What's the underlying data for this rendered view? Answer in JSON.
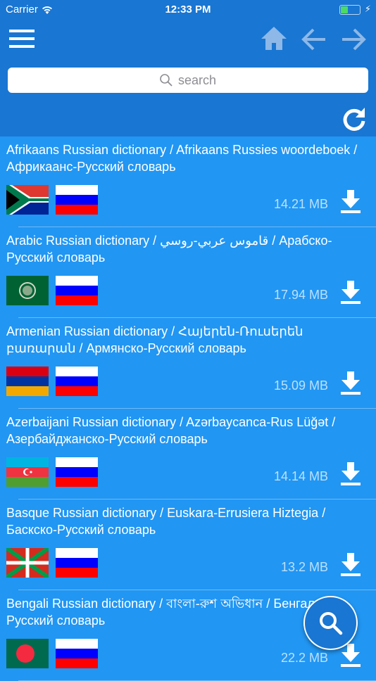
{
  "status": {
    "carrier": "Carrier",
    "time": "12:33 PM",
    "battery_level": 0.4
  },
  "search": {
    "placeholder": "search"
  },
  "colors": {
    "header": "#1976D2",
    "list": "#2196F3",
    "nav_disabled": "#8DB8E8"
  },
  "items": [
    {
      "title": "Afrikaans Russian dictionary / Afrikaans Russies woordeboek / Африкаанс-Русский словарь",
      "size": "14.21 MB",
      "flag": "south-africa"
    },
    {
      "title": "Arabic Russian dictionary / قاموس عربي-روسي / Арабско-Русский словарь",
      "size": "17.94 MB",
      "flag": "arab-league"
    },
    {
      "title": "Armenian Russian dictionary / Հայերեն-Ռուսերեն բառարան / Армянско-Русский словарь",
      "size": "15.09 MB",
      "flag": "armenia"
    },
    {
      "title": "Azerbaijani Russian dictionary / Azərbaycanca-Rus Lüğət / Азербайджанско-Русский словарь",
      "size": "14.14 MB",
      "flag": "azerbaijan"
    },
    {
      "title": "Basque Russian dictionary / Euskara-Errusiera Hiztegia / Баскско-Русский словарь",
      "size": "13.2 MB",
      "flag": "basque"
    },
    {
      "title": "Bengali Russian dictionary / বাংলা-রুশ অভিধান / Бенгальско-Русский словарь",
      "size": "22.2 MB",
      "flag": "bangladesh"
    }
  ]
}
